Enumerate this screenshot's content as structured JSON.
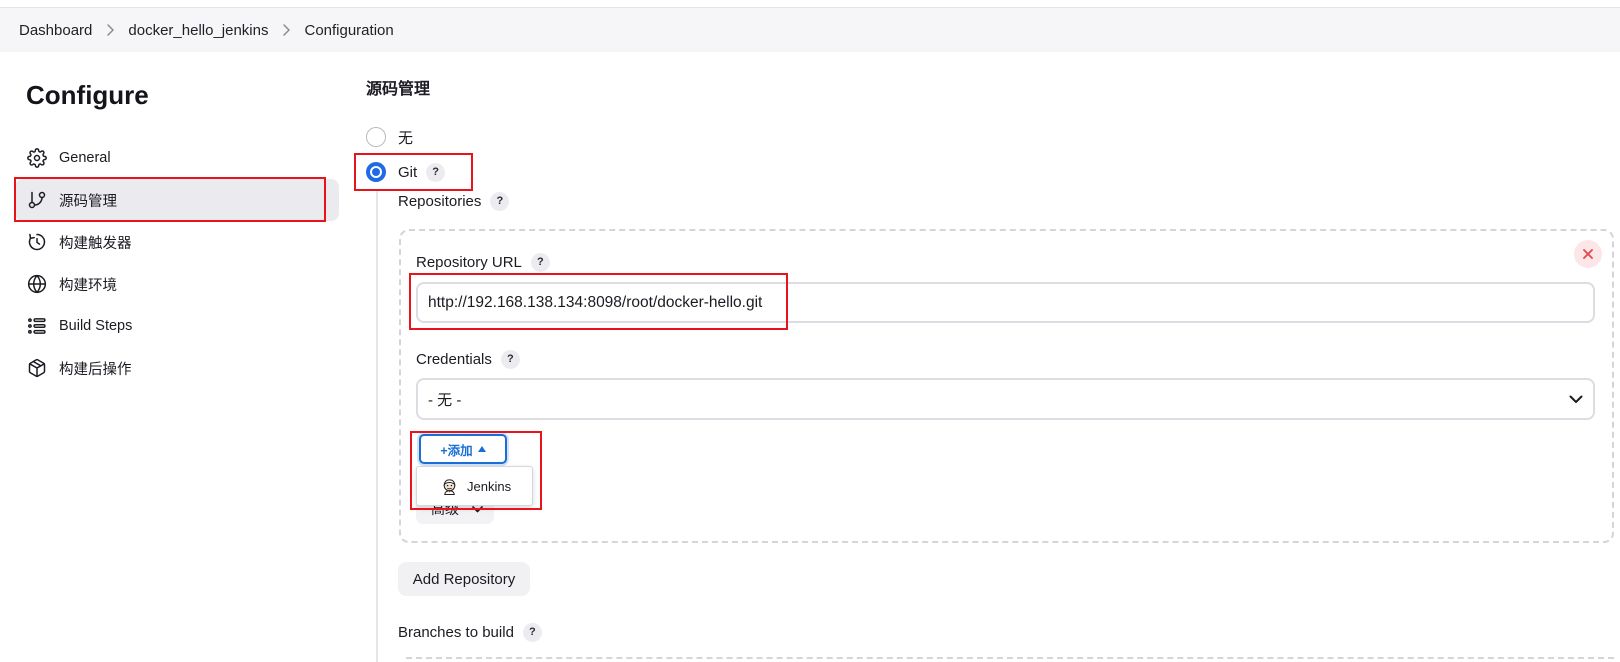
{
  "breadcrumb": [
    "Dashboard",
    "docker_hello_jenkins",
    "Configuration"
  ],
  "help_label": "?",
  "sidebar": {
    "title": "Configure",
    "items": [
      {
        "label": "General",
        "icon": "gear-icon",
        "active": false
      },
      {
        "label": "源码管理",
        "icon": "git-branch-icon",
        "active": true
      },
      {
        "label": "构建触发器",
        "icon": "timer-icon",
        "active": false
      },
      {
        "label": "构建环境",
        "icon": "globe-icon",
        "active": false
      },
      {
        "label": "Build Steps",
        "icon": "list-icon",
        "active": false
      },
      {
        "label": "构建后操作",
        "icon": "package-icon",
        "active": false
      }
    ]
  },
  "scm": {
    "heading": "源码管理",
    "options": [
      {
        "label": "无",
        "selected": false
      },
      {
        "label": "Git",
        "selected": true
      }
    ],
    "repositories": {
      "label": "Repositories",
      "remove_icon": "close-icon",
      "repository_url": {
        "label": "Repository URL",
        "value": "http://192.168.138.134:8098/root/docker-hello.git"
      },
      "credentials": {
        "label": "Credentials",
        "selected": "- 无 -"
      },
      "add_button": {
        "label": "+添加",
        "icon": "caret-up-icon"
      },
      "add_menu": {
        "items": [
          {
            "label": "Jenkins",
            "icon": "jenkins-icon"
          }
        ]
      },
      "advanced_button": {
        "label": "高级",
        "icon": "chevron-down-icon"
      }
    },
    "add_repository_label": "Add Repository",
    "branches": {
      "label": "Branches to build"
    }
  },
  "colors": {
    "accent": "#1f6ae5",
    "add_button": "#1a6fd6",
    "danger": "#e5484d",
    "annotation": "#e8141c",
    "sidebar_active_bg": "#ebebef",
    "breadcrumb_bg": "#f6f6f8"
  }
}
